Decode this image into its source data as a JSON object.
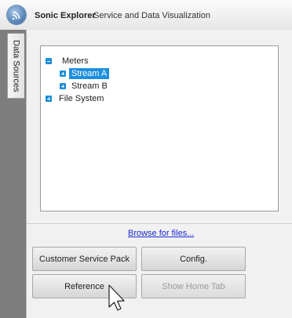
{
  "header": {
    "app_title": "Sonic Explorer",
    "app_subtitle": "Service and Data Visualization",
    "logo_icon": "wifi-signal-icon"
  },
  "side_tabs": [
    {
      "label": "Data Sources"
    }
  ],
  "tree": {
    "items": [
      {
        "label": "Meters",
        "toggle": "minus",
        "level": 0,
        "selected": false
      },
      {
        "label": "Stream A",
        "toggle": "plus",
        "level": 1,
        "selected": true
      },
      {
        "label": "Stream B",
        "toggle": "plus",
        "level": 1,
        "selected": false
      },
      {
        "label": "File System",
        "toggle": "plus",
        "level": 0,
        "selected": false
      }
    ]
  },
  "browse_link": "Browse for files...",
  "buttons": {
    "customer_service_pack": "Customer Service Pack",
    "config": "Config.",
    "reference": "Reference",
    "show_home_tab": "Show Home Tab"
  },
  "colors": {
    "selection": "#1e8fe0",
    "toggle": "#1c8fd6",
    "link": "#1a2bd1",
    "side_strip": "#7d7d7d"
  }
}
